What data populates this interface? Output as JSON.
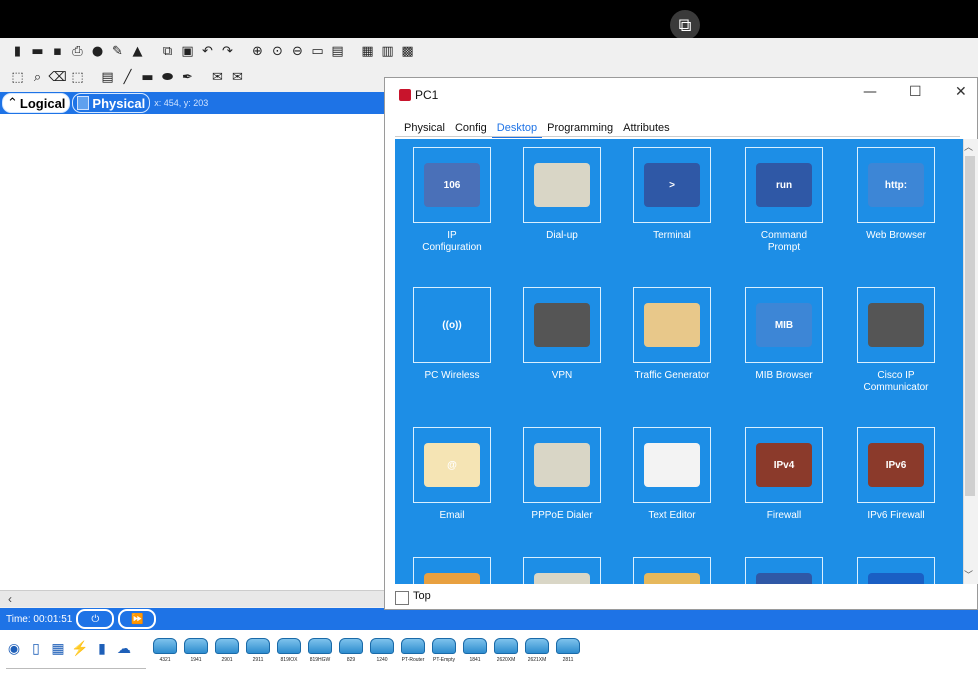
{
  "app": {
    "workspace_toggle": {
      "logical": "Logical",
      "physical": "Physical"
    },
    "coordinates": "x: 454, y: 203",
    "time": "Time: 00:01:51",
    "popout_icon": "popout-icon"
  },
  "toolbar1": [
    "new-file-icon",
    "open-icon",
    "save-icon",
    "print-icon",
    "info-icon",
    "activity-wizard-icon",
    "custom-device-icon",
    "copy-icon",
    "paste-icon",
    "undo-icon",
    "redo-icon",
    "zoom-in-icon",
    "zoom-reset-icon",
    "zoom-out-icon",
    "drawing-rect-icon",
    "palette-icon",
    "notes-icon",
    "custom-icon",
    "screenshot-icon"
  ],
  "toolbar2": [
    "select-icon",
    "inspect-icon",
    "delete-icon",
    "resize-icon",
    "note-icon",
    "line-icon",
    "rectangle-icon",
    "ellipse-icon",
    "freeform-icon",
    "add-pdu-icon",
    "complex-pdu-icon"
  ],
  "window": {
    "title": "PC1",
    "tabs": [
      "Physical",
      "Config",
      "Desktop",
      "Programming",
      "Attributes"
    ],
    "active_tab": "Desktop",
    "apps": [
      {
        "name": "IP Configuration",
        "line1": "IP",
        "line2": "Configuration",
        "icon": "ip-config-icon",
        "badge": "106",
        "color": "#4a70b8"
      },
      {
        "name": "Dial-up",
        "line1": "Dial-up",
        "line2": "",
        "icon": "modem-icon",
        "badge": "",
        "color": "#d9d6c6"
      },
      {
        "name": "Terminal",
        "line1": "Terminal",
        "line2": "",
        "icon": "terminal-icon",
        "badge": ">",
        "color": "#2f58a6"
      },
      {
        "name": "Command Prompt",
        "line1": "Command",
        "line2": "Prompt",
        "icon": "command-prompt-icon",
        "badge": "run",
        "color": "#2f58a6"
      },
      {
        "name": "Web Browser",
        "line1": "Web Browser",
        "line2": "",
        "icon": "web-browser-icon",
        "badge": "http:",
        "color": "#3d86d6"
      },
      {
        "name": "PC Wireless",
        "line1": "PC Wireless",
        "line2": "",
        "icon": "wireless-icon",
        "badge": "((o))",
        "color": "#1d8ee6"
      },
      {
        "name": "VPN",
        "line1": "VPN",
        "line2": "",
        "icon": "vpn-icon",
        "badge": "",
        "color": "#555"
      },
      {
        "name": "Traffic Generator",
        "line1": "Traffic Generator",
        "line2": "",
        "icon": "traffic-generator-icon",
        "badge": "",
        "color": "#e8c88a"
      },
      {
        "name": "MIB Browser",
        "line1": "MIB Browser",
        "line2": "",
        "icon": "mib-browser-icon",
        "badge": "MIB",
        "color": "#3d86d6"
      },
      {
        "name": "Cisco IP Communicator",
        "line1": "Cisco IP",
        "line2": "Communicator",
        "icon": "ip-communicator-icon",
        "badge": "",
        "color": "#555"
      },
      {
        "name": "Email",
        "line1": "Email",
        "line2": "",
        "icon": "email-icon",
        "badge": "@",
        "color": "#f5e4b4"
      },
      {
        "name": "PPPoE Dialer",
        "line1": "PPPoE Dialer",
        "line2": "",
        "icon": "pppoe-icon",
        "badge": "",
        "color": "#d9d6c6"
      },
      {
        "name": "Text Editor",
        "line1": "Text Editor",
        "line2": "",
        "icon": "text-editor-icon",
        "badge": "",
        "color": "#f3f3f3"
      },
      {
        "name": "Firewall",
        "line1": "Firewall",
        "line2": "",
        "icon": "firewall-icon",
        "badge": "IPv4",
        "color": "#8b3a2b"
      },
      {
        "name": "IPv6 Firewall",
        "line1": "IPv6 Firewall",
        "line2": "",
        "icon": "ipv6-firewall-icon",
        "badge": "IPv6",
        "color": "#8b3a2b"
      },
      {
        "name": "",
        "line1": "",
        "line2": "",
        "icon": "pie-chart-icon",
        "badge": "",
        "color": "#e8a040"
      },
      {
        "name": "",
        "line1": "",
        "line2": "",
        "icon": "server-box-icon",
        "badge": "",
        "color": "#d9d6c6"
      },
      {
        "name": "",
        "line1": "",
        "line2": "",
        "icon": "folder-icon",
        "badge": "",
        "color": "#e6b85c"
      },
      {
        "name": "",
        "line1": "",
        "line2": "",
        "icon": "terminal-icon",
        "badge": ">",
        "color": "#2f58a6"
      },
      {
        "name": "",
        "line1": "",
        "line2": "",
        "icon": "bluetooth-icon",
        "badge": "",
        "color": "#1a5fc4"
      }
    ],
    "top_checkbox": "Top",
    "top_checked": false
  },
  "palette": {
    "categories": [
      "network-devices-icon",
      "end-devices-icon",
      "components-icon",
      "connections-icon",
      "misc-icon",
      "multiuser-icon"
    ],
    "devices": [
      "4321",
      "1941",
      "2901",
      "2911",
      "819IOX",
      "819HGW",
      "829",
      "1240",
      "PT-Router",
      "PT-Empty",
      "1841",
      "2620XM",
      "2621XM",
      "2811"
    ]
  }
}
